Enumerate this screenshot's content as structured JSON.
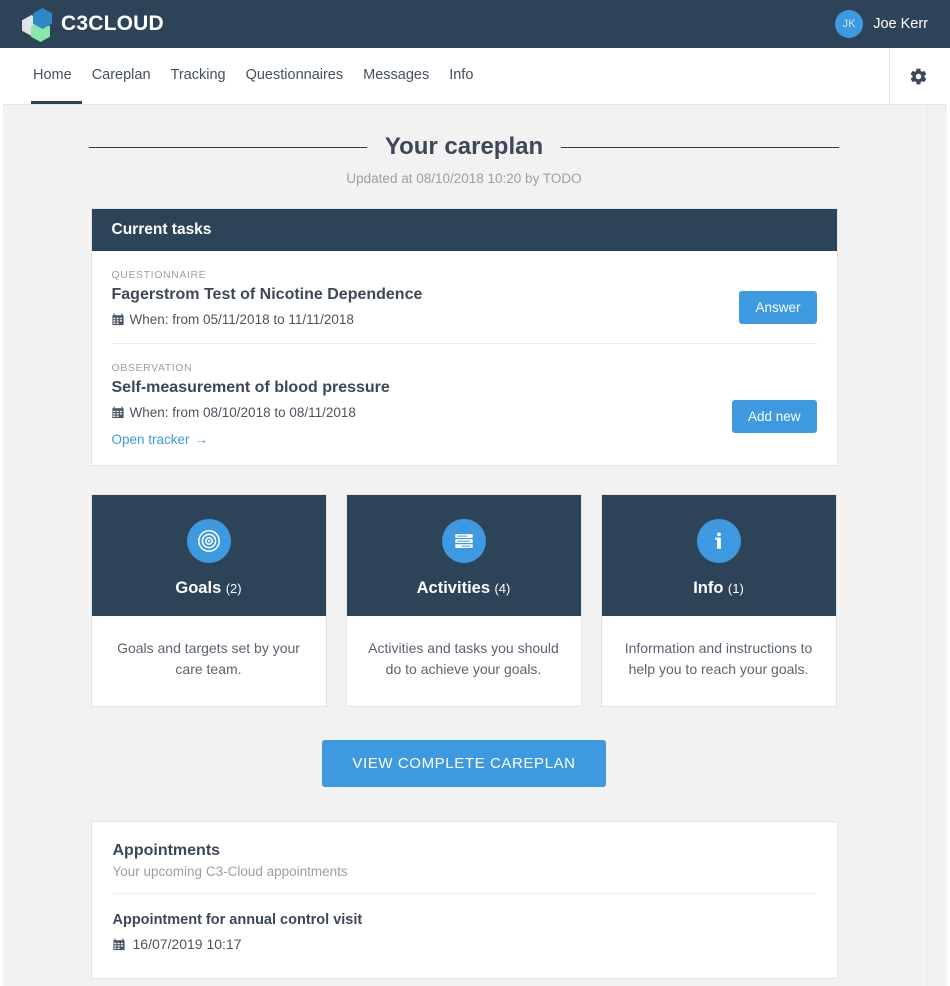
{
  "brand": {
    "name": "C3CLOUD",
    "logo_icon": "hexagon-cluster-logo"
  },
  "user": {
    "initials": "JK",
    "name": "Joe Kerr"
  },
  "nav": {
    "items": [
      {
        "label": "Home",
        "active": true
      },
      {
        "label": "Careplan",
        "active": false
      },
      {
        "label": "Tracking",
        "active": false
      },
      {
        "label": "Questionnaires",
        "active": false
      },
      {
        "label": "Messages",
        "active": false
      },
      {
        "label": "Info",
        "active": false
      }
    ],
    "settings_icon": "gear-icon"
  },
  "header": {
    "title": "Your careplan",
    "subtitle": "Updated at 08/10/2018 10:20 by TODO"
  },
  "tasks_card": {
    "heading": "Current tasks",
    "tasks": [
      {
        "kind": "QUESTIONNAIRE",
        "title": "Fagerstrom Test of Nicotine Dependence",
        "when": "When: from 05/11/2018 to 11/11/2018",
        "action_label": "Answer",
        "link_label": null
      },
      {
        "kind": "OBSERVATION",
        "title": "Self-measurement of blood pressure",
        "when": "When: from 08/10/2018 to 08/11/2018",
        "action_label": "Add new",
        "link_label": "Open tracker"
      }
    ]
  },
  "features": [
    {
      "label": "Goals",
      "count": "(2)",
      "icon": "bullseye-target-icon",
      "description": "Goals and targets set by your care team."
    },
    {
      "label": "Activities",
      "count": "(4)",
      "icon": "task-list-icon",
      "description": "Activities and tasks you should do to achieve your goals."
    },
    {
      "label": "Info",
      "count": "(1)",
      "icon": "info-circle-icon",
      "description": "Information and instructions to help you to reach your goals."
    }
  ],
  "cta": {
    "label": "VIEW COMPLETE CAREPLAN"
  },
  "appointments": {
    "title": "Appointments",
    "subtitle": "Your upcoming C3-Cloud appointments",
    "items": [
      {
        "title": "Appointment for annual control visit",
        "when": "16/07/2019 10:17"
      }
    ]
  },
  "colors": {
    "dark": "#2d4357",
    "accent": "#3d9ae0",
    "page_bg": "#f2f2f2",
    "muted": "#9aa0a6"
  }
}
